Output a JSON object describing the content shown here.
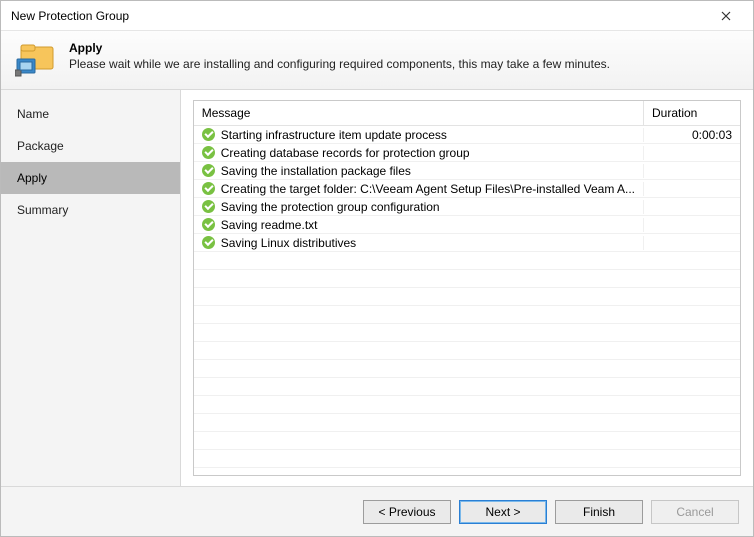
{
  "window": {
    "title": "New Protection Group"
  },
  "header": {
    "title": "Apply",
    "subtitle": "Please wait while we are installing and configuring required components, this may take a few minutes."
  },
  "sidebar": {
    "steps": [
      {
        "label": "Name",
        "active": false
      },
      {
        "label": "Package",
        "active": false
      },
      {
        "label": "Apply",
        "active": true
      },
      {
        "label": "Summary",
        "active": false
      }
    ]
  },
  "grid": {
    "columns": {
      "message": "Message",
      "duration": "Duration"
    },
    "rows": [
      {
        "status": "success",
        "message": "Starting infrastructure item update process",
        "duration": "0:00:03"
      },
      {
        "status": "success",
        "message": "Creating database records for protection group",
        "duration": ""
      },
      {
        "status": "success",
        "message": "Saving the installation package files",
        "duration": ""
      },
      {
        "status": "success",
        "message": "Creating the target folder: C:\\Veeam Agent Setup Files\\Pre-installed Veam A...",
        "duration": ""
      },
      {
        "status": "success",
        "message": "Saving the protection group configuration",
        "duration": ""
      },
      {
        "status": "success",
        "message": "Saving readme.txt",
        "duration": ""
      },
      {
        "status": "success",
        "message": "Saving Linux distributives",
        "duration": ""
      }
    ],
    "blank_row_count": 12
  },
  "footer": {
    "previous": "< Previous",
    "next": "Next >",
    "finish": "Finish",
    "cancel": "Cancel"
  }
}
